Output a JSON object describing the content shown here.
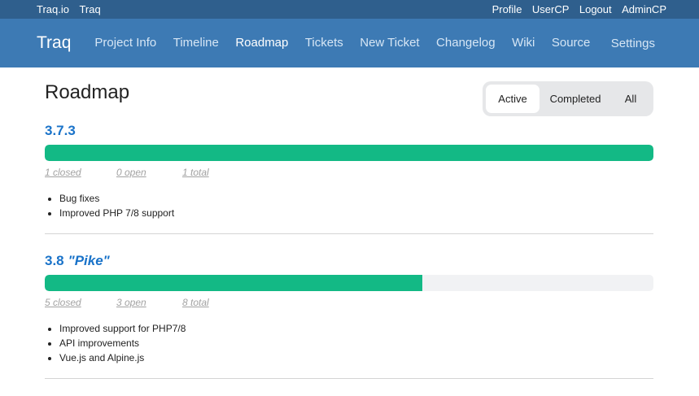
{
  "topbar": {
    "left": [
      "Traq.io",
      "Traq"
    ],
    "right": [
      "Profile",
      "UserCP",
      "Logout",
      "AdminCP"
    ]
  },
  "navbar": {
    "brand": "Traq",
    "items": [
      "Project Info",
      "Timeline",
      "Roadmap",
      "Tickets",
      "New Ticket",
      "Changelog",
      "Wiki",
      "Source"
    ],
    "active": "Roadmap",
    "settings": "Settings"
  },
  "page": {
    "title": "Roadmap",
    "filters": [
      "Active",
      "Completed",
      "All"
    ],
    "selected_filter": "Active"
  },
  "milestones": [
    {
      "version": "3.7.3",
      "codename": "",
      "progress_percent": 100,
      "closed": "1 closed",
      "open": "0 open",
      "total": "1 total",
      "notes": [
        "Bug fixes",
        "Improved PHP 7/8 support"
      ]
    },
    {
      "version": "3.8",
      "codename": "\"Pike\"",
      "progress_percent": 62,
      "closed": "5 closed",
      "open": "3 open",
      "total": "8 total",
      "notes": [
        "Improved support for PHP7/8",
        "API improvements",
        "Vue.js and Alpine.js"
      ]
    }
  ],
  "colors": {
    "topbar": "#2f5f8d",
    "navbar": "#3d7ab4",
    "progress_fill": "#13b985",
    "progress_track": "#f1f2f4",
    "link": "#1a73c9"
  }
}
